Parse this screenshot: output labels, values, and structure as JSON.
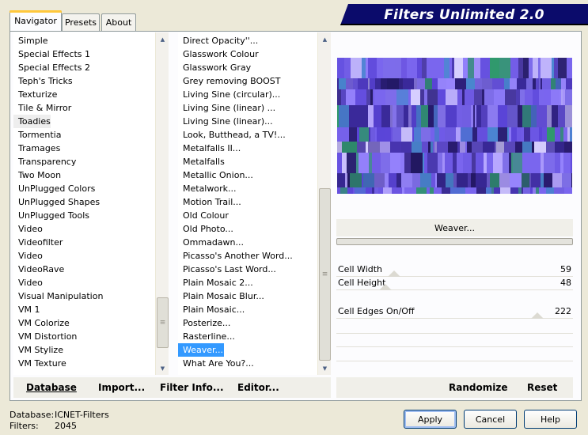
{
  "title": "Filters Unlimited 2.0",
  "tabs": [
    {
      "label": "Navigator",
      "active": true
    },
    {
      "label": "Presets",
      "active": false
    },
    {
      "label": "About",
      "active": false
    }
  ],
  "categories": [
    "Simple",
    "Special Effects 1",
    "Special Effects 2",
    "Teph's Tricks",
    "Texturize",
    "Tile & Mirror",
    "Toadies",
    "Tormentia",
    "Tramages",
    "Transparency",
    "Two Moon",
    "UnPlugged Colors",
    "UnPlugged Shapes",
    "UnPlugged Tools",
    "Video",
    "Videofilter",
    "Video",
    "VideoRave",
    "Video",
    "Visual Manipulation",
    "VM 1",
    "VM Colorize",
    "VM Distortion",
    "VM Stylize",
    "VM Texture"
  ],
  "highlighted_category": "Toadies",
  "filters": [
    "Direct Opacity''...",
    "Glasswork Colour",
    "Glasswork Gray",
    "Grey removing BOOST",
    "Living Sine (circular)...",
    "Living Sine (linear) ...",
    "Living Sine (linear)...",
    "Look, Butthead, a TV!...",
    "Metalfalls II...",
    "Metalfalls",
    "Metallic Onion...",
    "Metalwork...",
    "Motion Trail...",
    "Old Colour",
    "Old Photo...",
    "Ommadawn...",
    "Picasso's Another Word...",
    "Picasso's Last Word...",
    "Plain Mosaic 2...",
    "Plain Mosaic Blur...",
    "Plain Mosaic...",
    "Posterize...",
    "Rasterline...",
    "Weaver...",
    "What Are You?..."
  ],
  "selected_filter": "Weaver...",
  "filter_name": "Weaver...",
  "params": [
    {
      "label": "Cell Width",
      "value": "59",
      "level": 0.23
    },
    {
      "label": "Cell Height",
      "value": "48",
      "level": 0.19
    },
    {
      "label": "Cell Edges On/Off",
      "value": "222",
      "level": 0.87
    }
  ],
  "buttons": {
    "database": "Database",
    "import": "Import...",
    "filter_info": "Filter Info...",
    "editor": "Editor...",
    "randomize": "Randomize",
    "reset": "Reset",
    "apply": "Apply",
    "cancel": "Cancel",
    "help": "Help"
  },
  "footer": {
    "database_label": "Database:",
    "database_value": "ICNET-Filters",
    "filters_label": "Filters:",
    "filters_value": "2045"
  },
  "colors": {
    "selection": "#3399ff",
    "title_bg": "#0b0b6b",
    "preview_purple": "#5a3fd0"
  }
}
